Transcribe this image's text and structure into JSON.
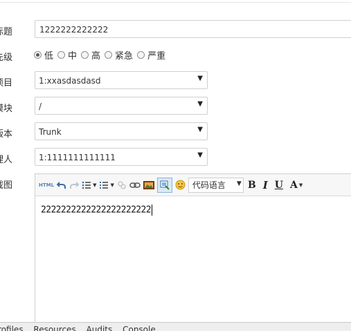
{
  "form": {
    "title_label": "标题",
    "title_value": "1222222222222",
    "priority_label": "先级",
    "priority_options": [
      "低",
      "中",
      "高",
      "紧急",
      "严重"
    ],
    "priority_selected": "低",
    "project_label": "项目",
    "project_value": "1:xxasdasdasd",
    "module_label": "模块",
    "module_value": "/",
    "version_label": "版本",
    "version_value": "Trunk",
    "assignee_label": "理人",
    "assignee_value": "1:1111111111111",
    "screenshot_label": "截图"
  },
  "editor": {
    "html_button": "HTML",
    "font_select": "代码语言",
    "bold": "B",
    "italic": "I",
    "underline": "U",
    "font_color": "A",
    "content": "2222222222222222222222"
  },
  "devtools": {
    "tabs": [
      "Profiles",
      "Resources",
      "Audits",
      "Console"
    ]
  },
  "icons": {
    "undo": "undo-icon",
    "redo": "redo-icon",
    "unordered_list": "unordered-list-icon",
    "ordered_list": "ordered-list-icon",
    "unlink": "unlink-icon",
    "link": "link-icon",
    "image": "image-icon",
    "screenshot": "screenshot-icon",
    "emoticon": "emoticon-icon"
  }
}
